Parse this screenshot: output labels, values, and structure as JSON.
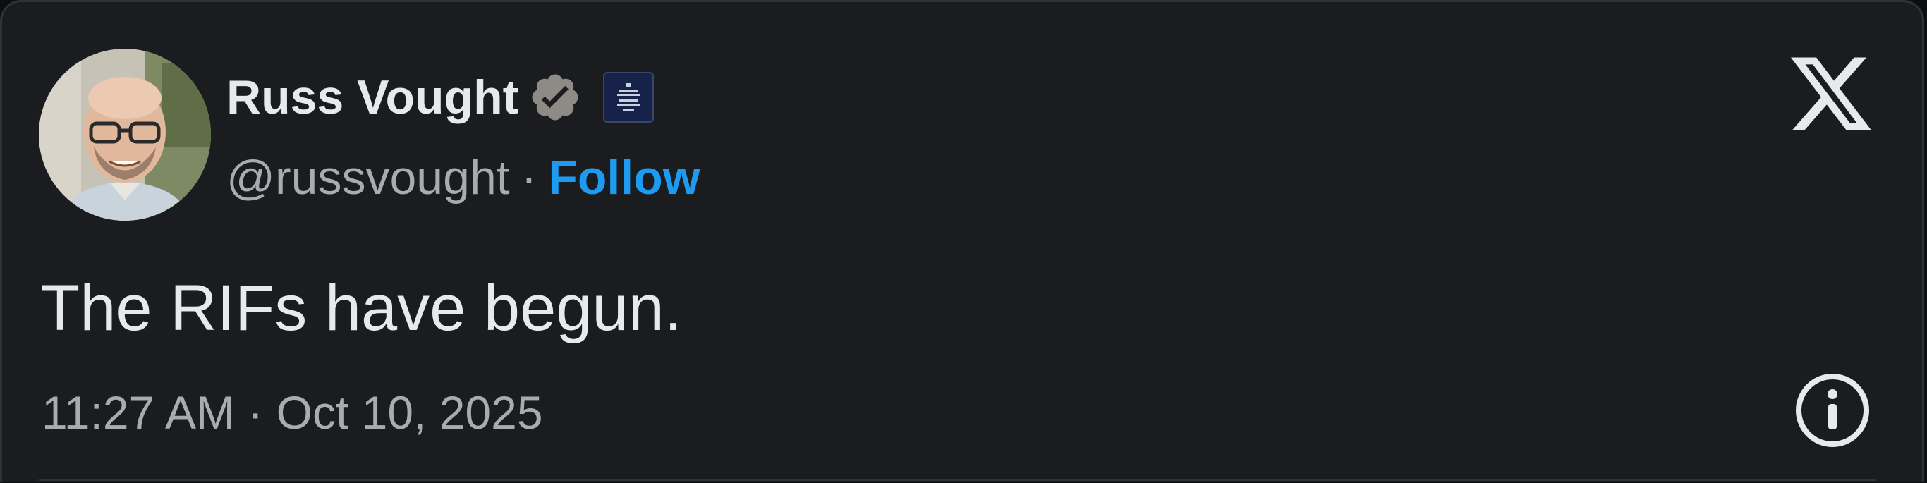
{
  "tweet": {
    "author": {
      "display_name": "Russ Vought",
      "handle": "@russvought",
      "verified": true,
      "affiliation_badge": "white-house-badge"
    },
    "separator": "·",
    "follow_label": "Follow",
    "text": "The RIFs have begun.",
    "timestamp": "11:27 AM · Oct 10, 2025"
  },
  "icons": {
    "platform_logo": "x-logo-icon",
    "verified": "verified-badge-icon",
    "info": "info-icon"
  },
  "colors": {
    "background": "#1b1c1f",
    "text_primary": "#e7e9ea",
    "text_secondary": "#a7acb1",
    "link": "#1d9bf0",
    "verified_badge": "#8e8a84",
    "affiliation_badge": "#16224a"
  }
}
